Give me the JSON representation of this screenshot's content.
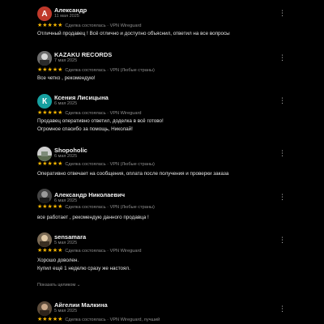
{
  "colors": {
    "background": "#000000",
    "star": "#f4b400",
    "muted": "#8f8f8f"
  },
  "reviews": [
    {
      "name": "Александр",
      "date": "11 мая 2025",
      "rating": 5,
      "stars": "★★★★★",
      "deal": "Сделка состоялась · VPN Wireguard",
      "lines": [
        "Отличный продавец ! Всё отлично и доступно объяснил, ответил на все вопросы"
      ],
      "avatar": {
        "type": "letter",
        "letter": "A",
        "color": "#c0392b"
      }
    },
    {
      "name": "KAZAKU RECORDS",
      "date": "7 мая 2025",
      "rating": 5,
      "stars": "★★★★★",
      "deal": "Сделка состоялась · VPN (Любые страны)",
      "lines": [
        "Все четко , рекомендую!"
      ],
      "avatar": {
        "type": "photo"
      }
    },
    {
      "name": "Ксения Лисицына",
      "date": "6 мая 2025",
      "rating": 5,
      "stars": "★★★★★",
      "deal": "Сделка состоялась · VPN Wireguard",
      "lines": [
        "Продавец оперативно ответил, доделка в всё готово!",
        "Огромное спасибо за помощь, Николай!"
      ],
      "avatar": {
        "type": "letter",
        "letter": "К",
        "color": "#16a0a0"
      }
    },
    {
      "name": "Shopoholic",
      "date": "6 мая 2025",
      "rating": 5,
      "stars": "★★★★★",
      "deal": "Сделка состоялась · VPN (Любые страны)",
      "lines": [
        "Оперативно отвечает на сообщения, оплата после получения и проверки заказа"
      ],
      "avatar": {
        "type": "photo"
      }
    },
    {
      "name": "Александр Николаевич",
      "date": "6 мая 2025",
      "rating": 5,
      "stars": "★★★★★",
      "deal": "Сделка состоялась · VPN (Любые страны)",
      "lines": [
        "все работает , рекомендую данного продавца !"
      ],
      "avatar": {
        "type": "photo"
      }
    },
    {
      "name": "sensamara",
      "date": "5 мая 2025",
      "rating": 5,
      "stars": "★★★★★",
      "deal": "Сделка состоялась · VPN Wireguard",
      "lines": [
        "Хорошо доволен.",
        "Купил ещё 1 неделю сразу же настоял."
      ],
      "more": "Показать целиком ⌄",
      "avatar": {
        "type": "photo"
      }
    },
    {
      "name": "Айгелии Малкина",
      "date": "5 мая 2025",
      "rating": 5,
      "stars": "★★★★★",
      "deal": "Сделка состоялась · VPN Wireguard, лучший",
      "lines": [],
      "avatar": {
        "type": "photo"
      }
    }
  ],
  "icons": {
    "menu": "more-vertical-icon",
    "star": "star-icon"
  }
}
